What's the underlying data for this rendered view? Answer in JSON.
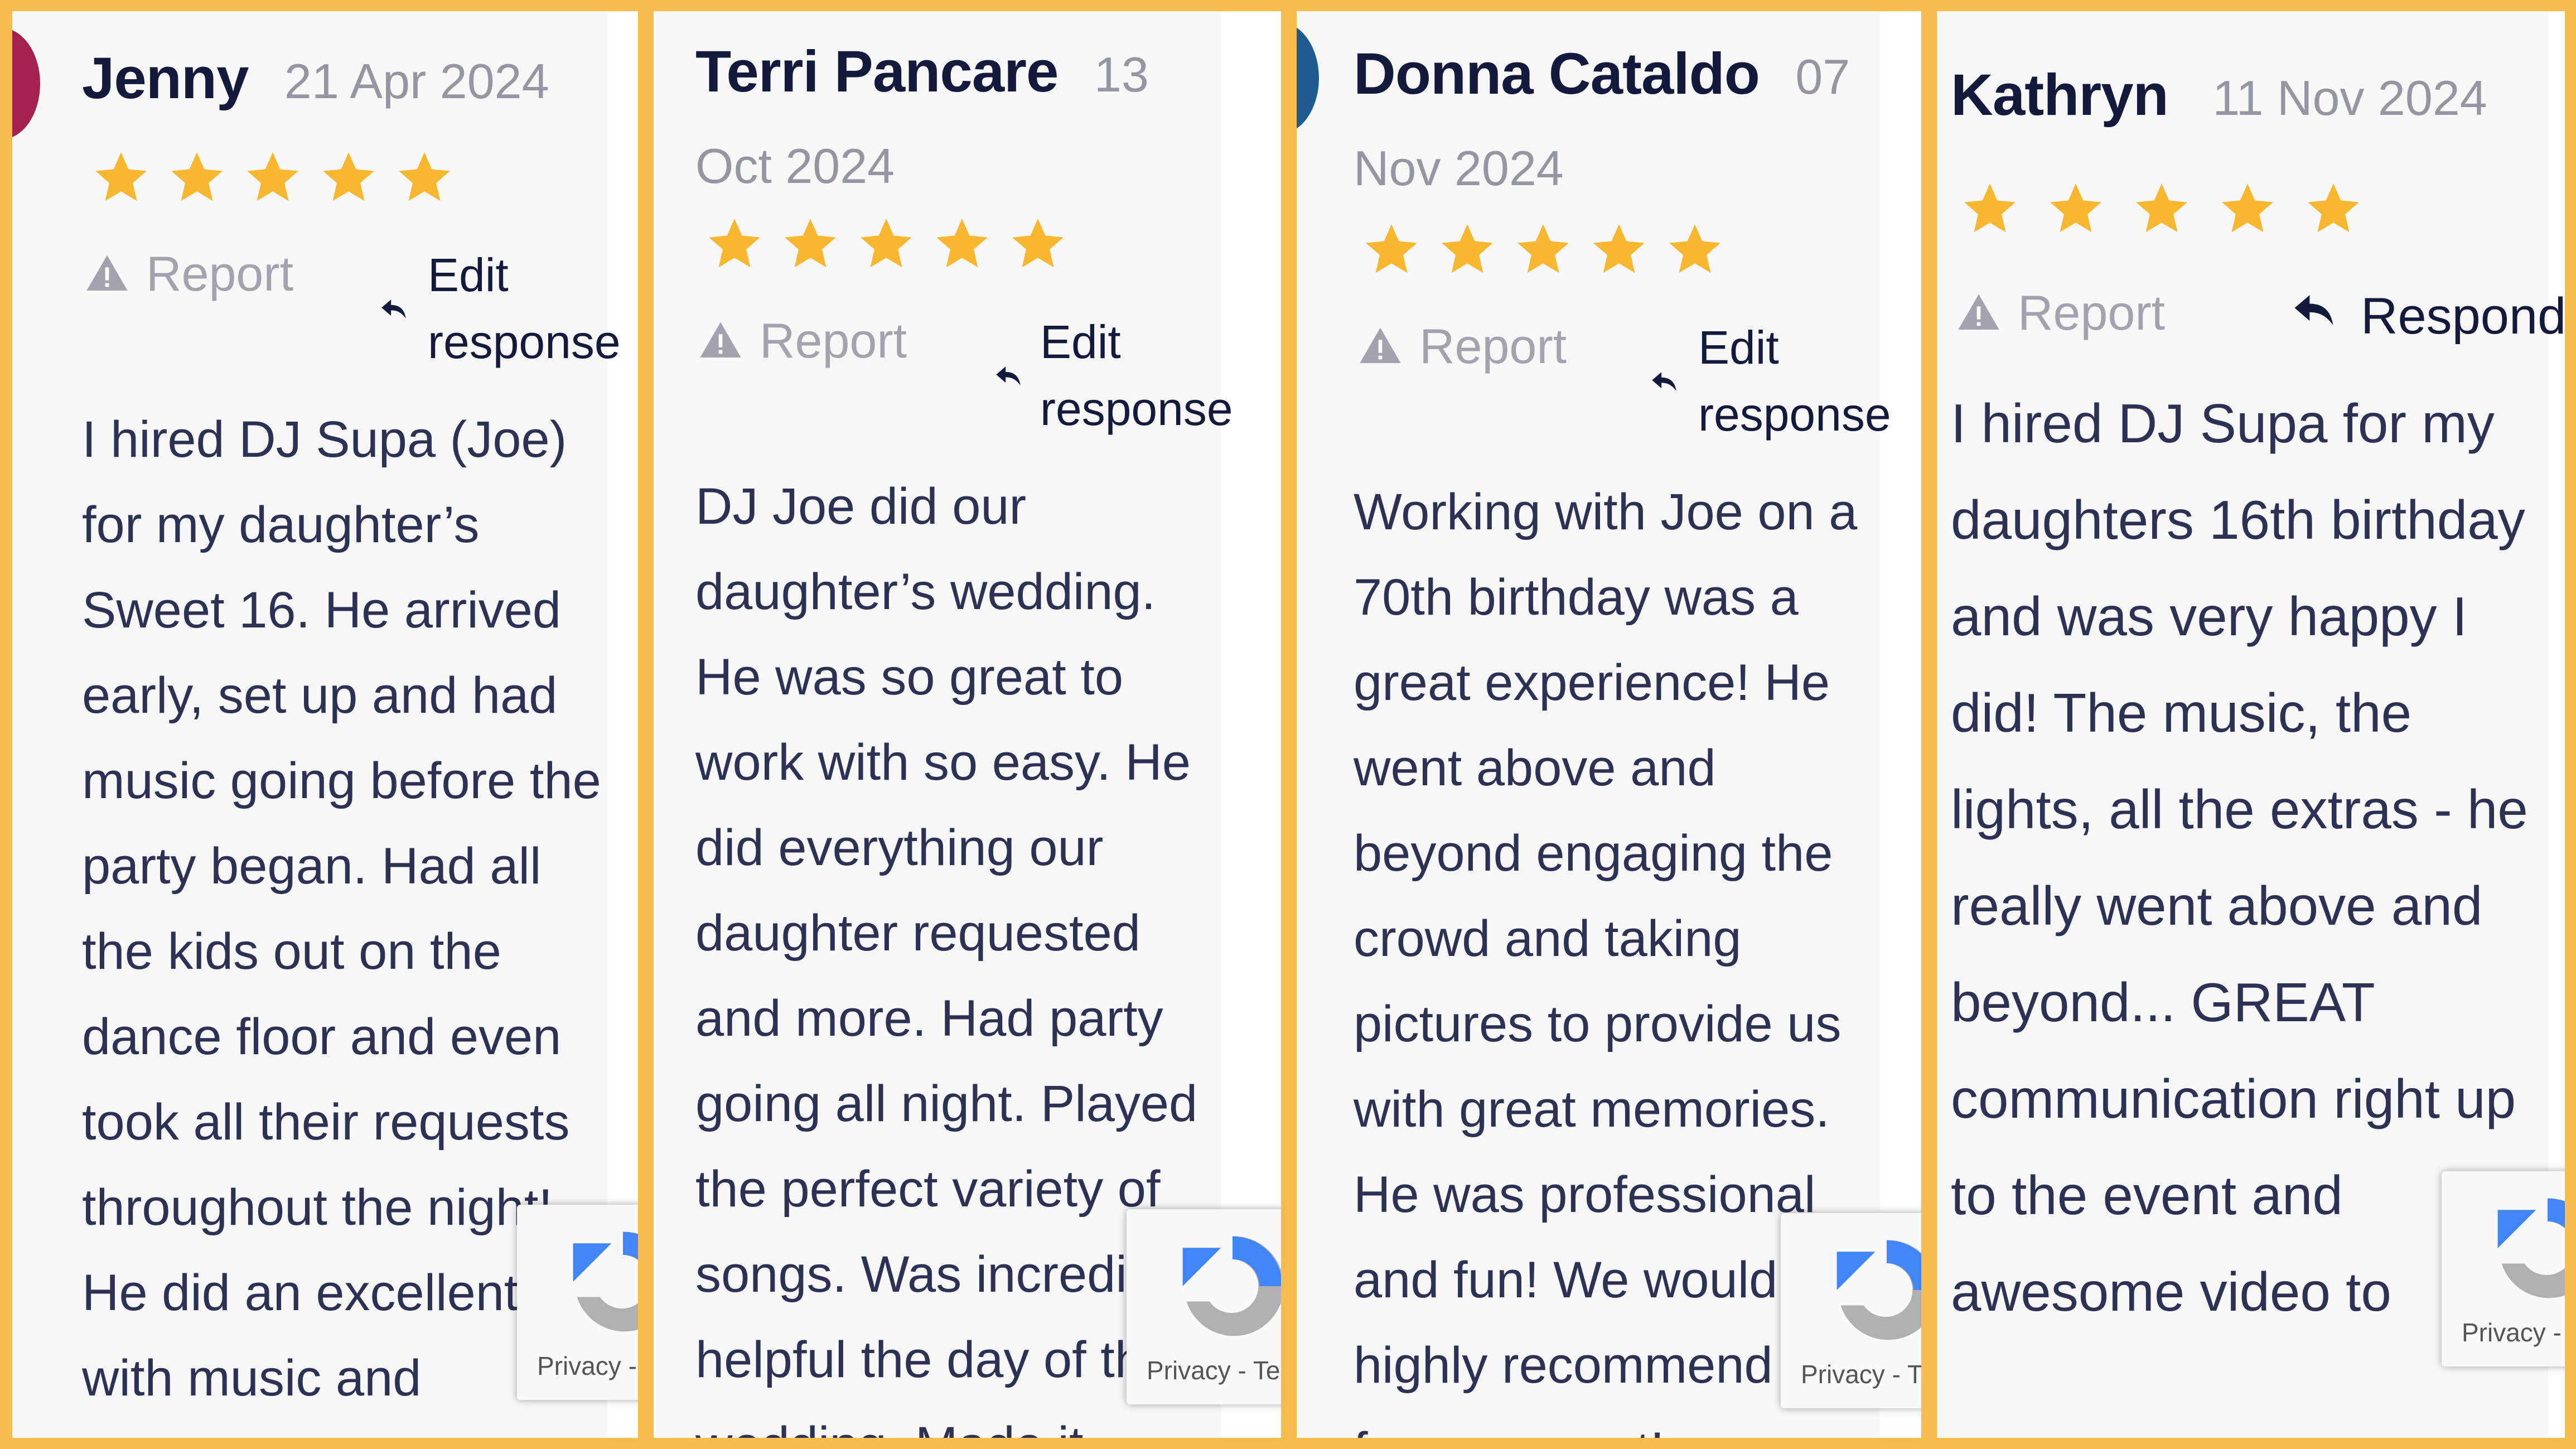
{
  "colors": {
    "frame": "#f6bd4e",
    "star": "#f7b731",
    "name": "#141a3c",
    "date": "#9496a2",
    "text": "#2d3254"
  },
  "reviews": [
    {
      "name": "Jenny",
      "date": "21 Apr 2024",
      "rating": 5,
      "report_label": "Report",
      "edit_label": "Edit response",
      "text": "I hired DJ Supa (Joe) for my daughter’s Sweet 16. He arrived early, set up and had music going before the party began. Had all the kids out on the dance floor and even took all their requests throughout the night! He did an excellent job with music and"
    },
    {
      "name": "Terri Pancare",
      "date": "13 Oct 2024",
      "rating": 5,
      "report_label": "Report",
      "edit_label": "Edit response",
      "text": "DJ Joe did our daughter’s wedding. He was so great to work with so easy. He did everything our daughter requested and more. Had party going all night. Played the perfect variety of songs. Was incredibly helpful the day of the wedding. Made it"
    },
    {
      "name": "Donna Cataldo",
      "date": "07 Nov 2024",
      "rating": 5,
      "report_label": "Report",
      "edit_label": "Edit response",
      "text": "Working with Joe on a 70th birthday was a great experience! He went above and beyond engaging the crowd and taking pictures to provide us with great memories. He was professional and fun! We would highly recommend him for any event!"
    },
    {
      "name": "Kathryn",
      "date": "11 Nov 2024",
      "rating": 5,
      "report_label": "Report",
      "edit_label": "Respond",
      "text": "I hired DJ Supa for my daughters 16th birthday and was very happy I did! The music, the lights, all the extras - he really went above and beyond... GREAT communication right up to the event and awesome video to"
    }
  ],
  "recaptcha": {
    "label": "Privacy - Terms"
  }
}
